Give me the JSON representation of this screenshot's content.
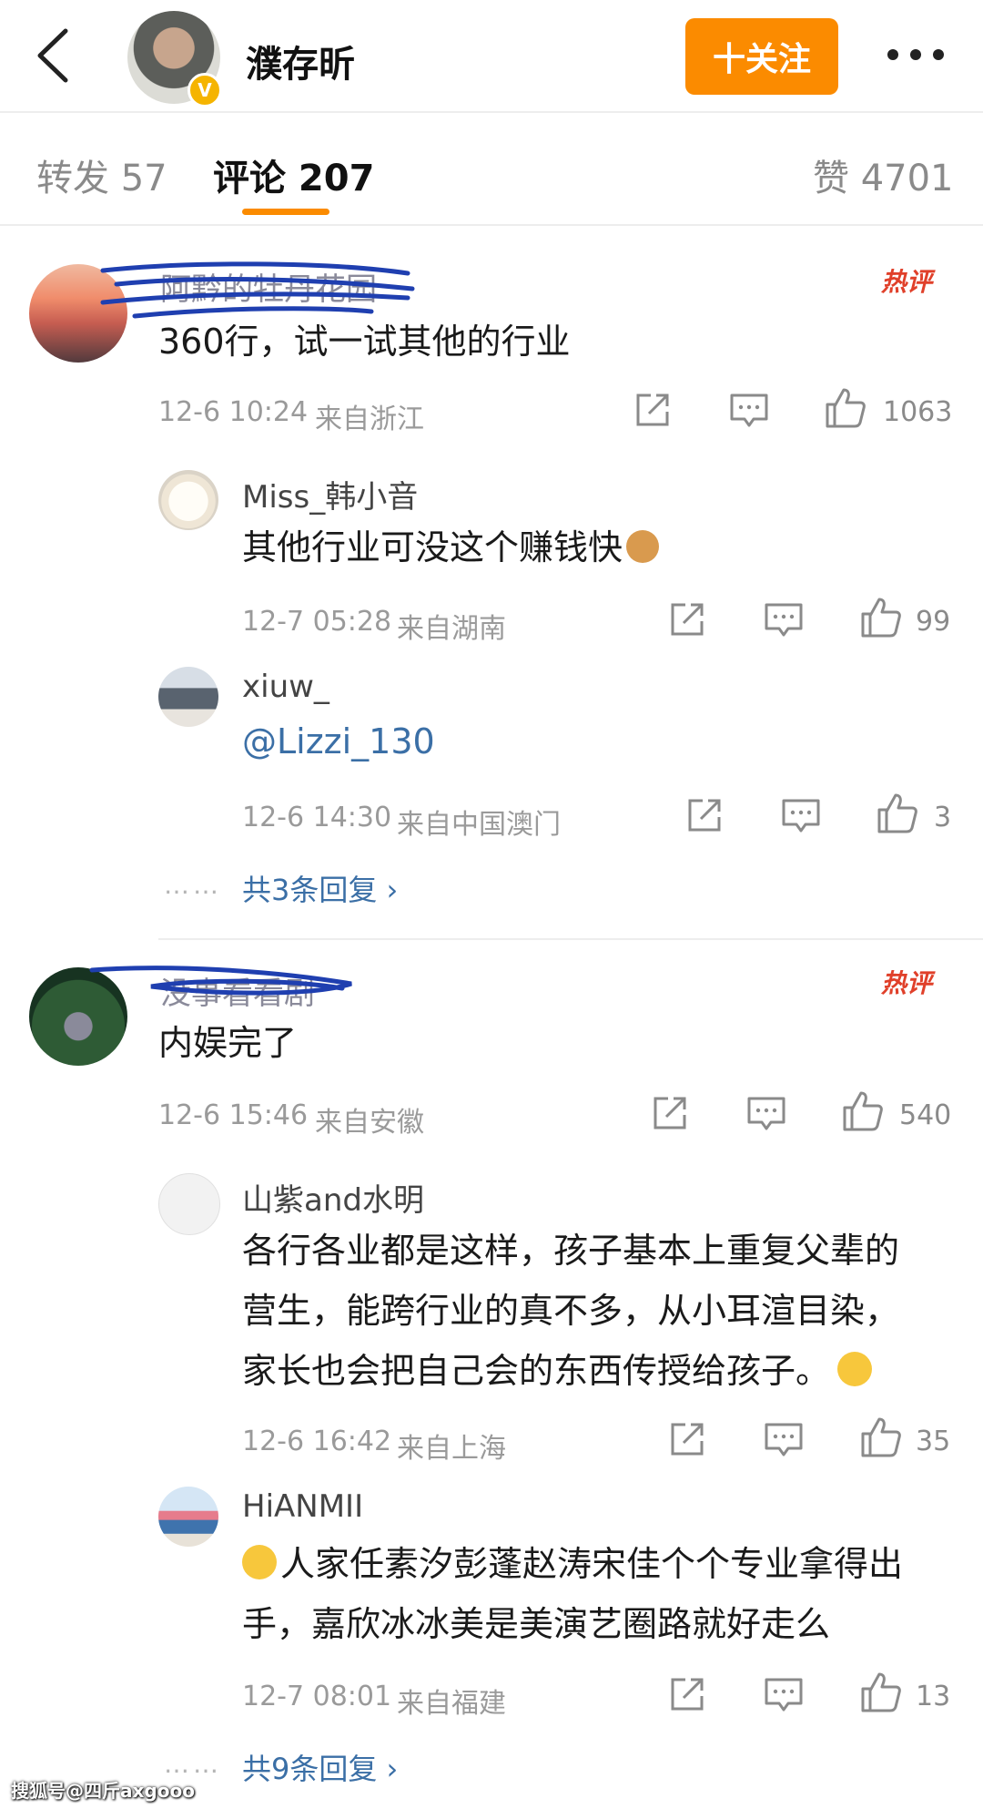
{
  "header": {
    "username": "濮存昕",
    "verified_badge": "V",
    "follow_label": "十关注"
  },
  "tabs": {
    "repost": "转发 57",
    "comments": "评论 207",
    "likes": "赞 4701"
  },
  "comments": [
    {
      "username": "阿黔的牡丹花园",
      "hot": "热评",
      "text": "360行，试一试其他的行业",
      "time": "12-6 10:24",
      "location": "来自浙江",
      "likes": "1063",
      "replies": [
        {
          "username": "Miss_韩小音",
          "text": "其他行业可没这个赚钱快",
          "emoji": "money-bag-emoji",
          "time": "12-7 05:28",
          "location": "来自湖南",
          "likes": "99"
        },
        {
          "username": "xiuw_",
          "mention": "@Lizzi_130",
          "time": "12-6 14:30",
          "location": "来自中国澳门",
          "likes": "3"
        }
      ],
      "more_replies": "共3条回复 ›"
    },
    {
      "username": "没事看看剧",
      "hot": "热评",
      "text": "内娱完了",
      "time": "12-6 15:46",
      "location": "来自安徽",
      "likes": "540",
      "replies": [
        {
          "username": "山紫and水明",
          "text_lines": [
            "各行各业都是这样，孩子基本上重复父辈的",
            "营生，能跨行业的真不多，从小耳渲目染，",
            "家长也会把自己会的东西传授给孩子。"
          ],
          "emoji": "laugh-cry-emoji",
          "time": "12-6 16:42",
          "location": "来自上海",
          "likes": "35"
        },
        {
          "username": "HiANMII",
          "text_lines": [
            "人家任素汐彭蓬赵涛宋佳个个专业拿得出",
            "手，嘉欣冰冰美是美演艺圈路就好走么"
          ],
          "emoji": "laugh-cry-emoji",
          "time": "12-7 08:01",
          "location": "来自福建",
          "likes": "13"
        }
      ],
      "more_replies": "共9条回复 ›"
    }
  ],
  "dots": "……",
  "watermark": "搜狐号@四斤axgooo",
  "colors": {
    "accent": "#fb8b00",
    "link": "#3b6fa6",
    "hot": "#e0402a"
  }
}
